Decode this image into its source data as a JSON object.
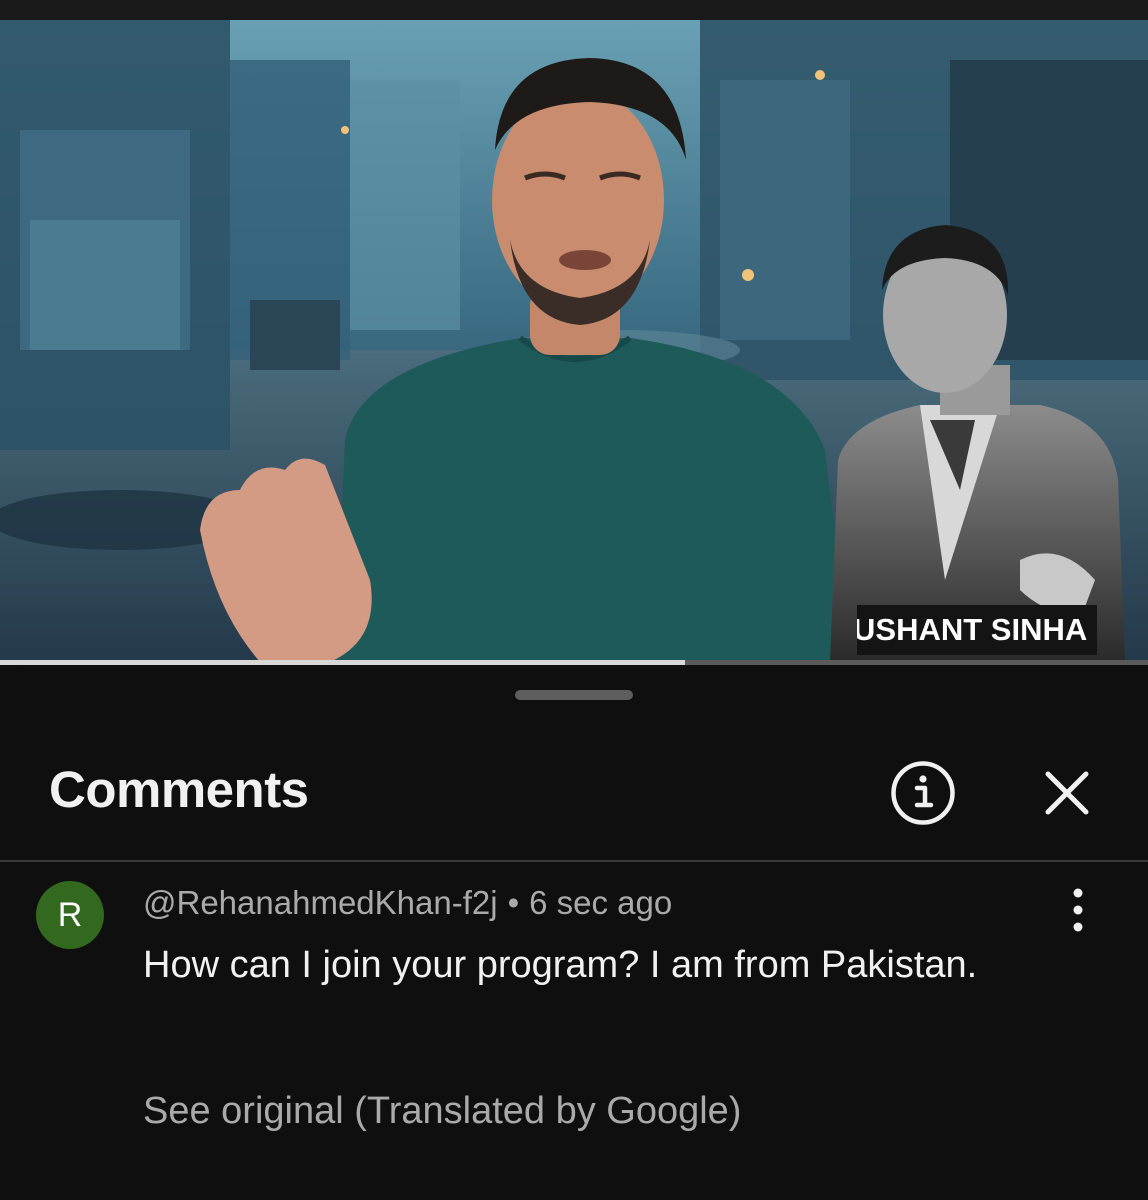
{
  "video": {
    "lower_third_name": "USHANT SINHA",
    "progress_fraction": 0.597
  },
  "comments_panel": {
    "title": "Comments",
    "info_icon": "info-circle-icon",
    "close_icon": "close-x-icon"
  },
  "comment": {
    "avatar_letter": "R",
    "avatar_color": "#33691e",
    "author": "@RehanahmedKhan-f2j",
    "separator": "•",
    "timestamp": "6 sec ago",
    "text": "How can I join your program? I am from Pakistan.",
    "see_original": "See original (Translated by Google)",
    "menu_icon": "more-vertical-icon"
  }
}
